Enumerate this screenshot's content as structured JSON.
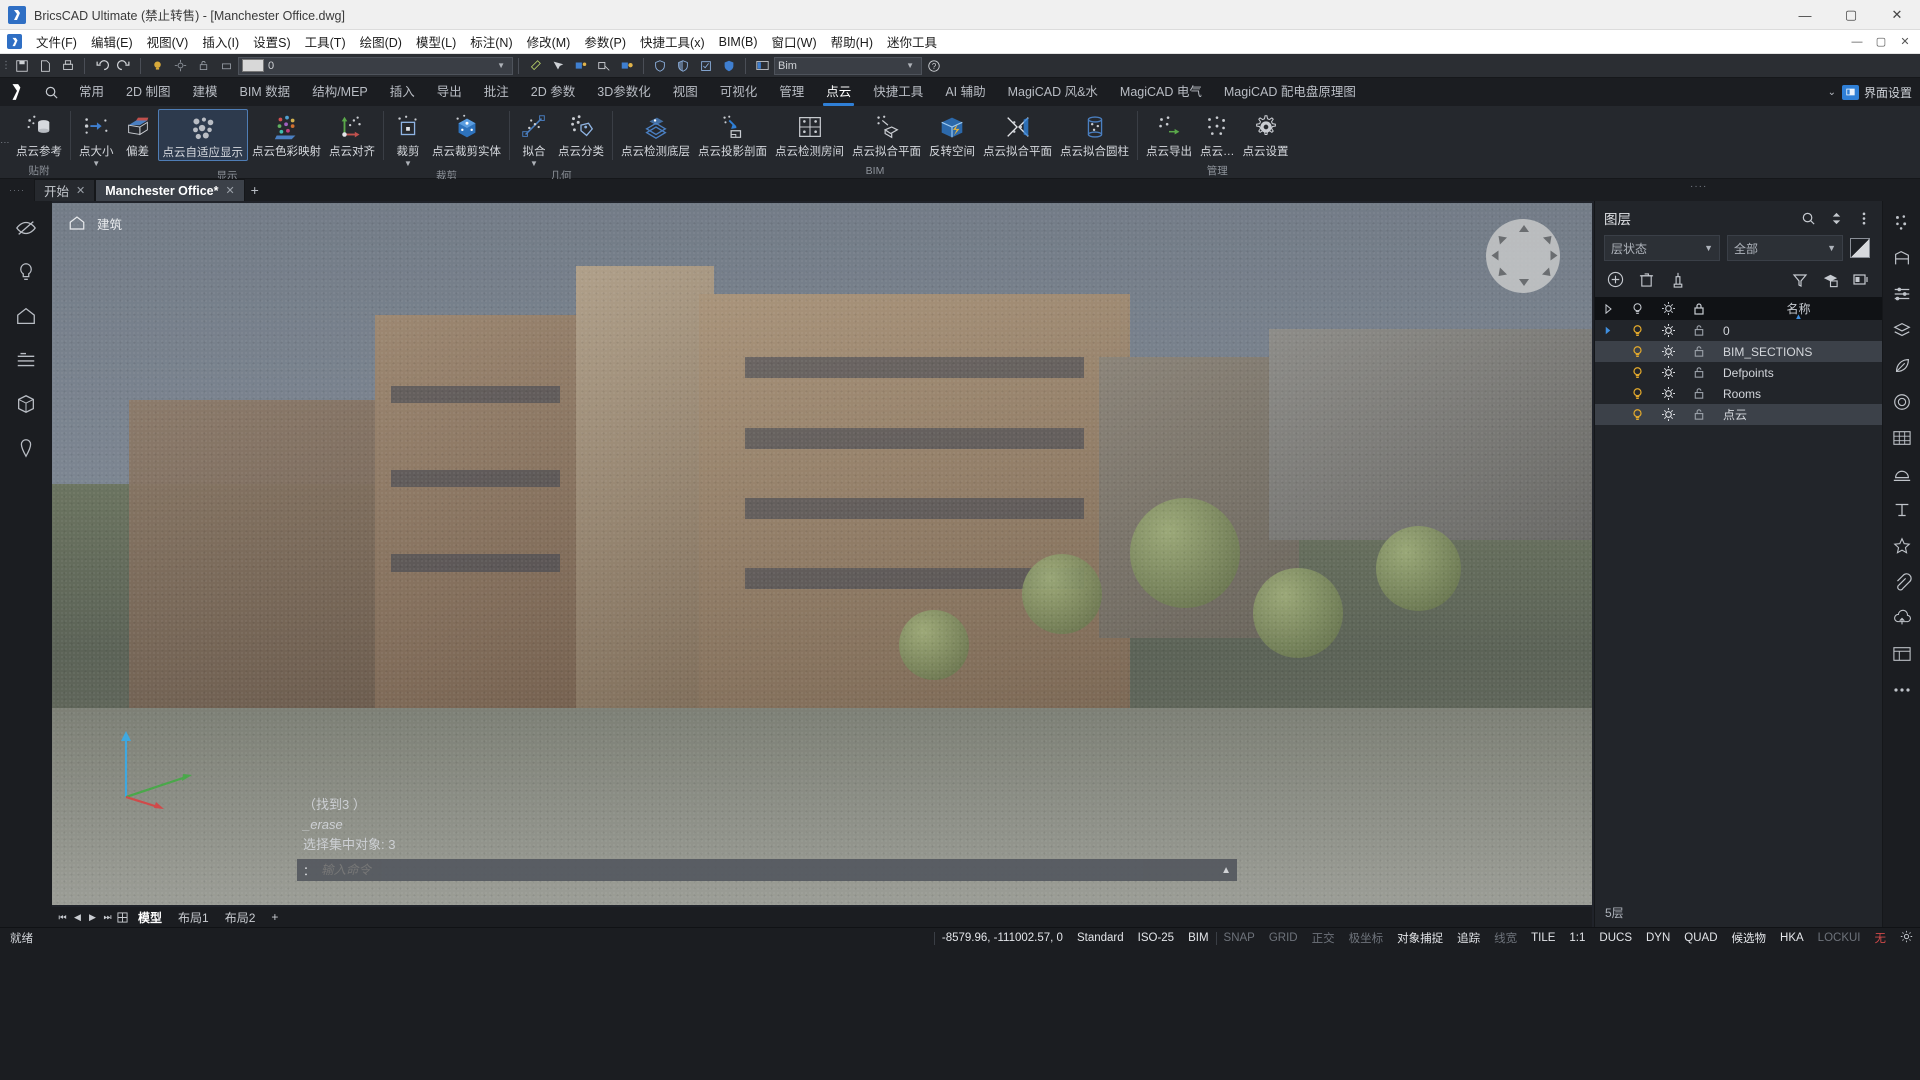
{
  "titlebar": {
    "app_title": "BricsCAD Ultimate (禁止转售) - [Manchester Office.dwg]",
    "logo": "bricscad-logo",
    "minimize": "—",
    "maximize": "▢",
    "close": "✕"
  },
  "menubar": {
    "items": [
      {
        "label": "文件(F)"
      },
      {
        "label": "编辑(E)"
      },
      {
        "label": "视图(V)"
      },
      {
        "label": "插入(I)"
      },
      {
        "label": "设置S)"
      },
      {
        "label": "工具(T)"
      },
      {
        "label": "绘图(D)"
      },
      {
        "label": "模型(L)"
      },
      {
        "label": "标注(N)"
      },
      {
        "label": "修改(M)"
      },
      {
        "label": "参数(P)"
      },
      {
        "label": "快捷工具(x)"
      },
      {
        "label": "BIM(B)"
      },
      {
        "label": "窗口(W)"
      },
      {
        "label": "帮助(H)"
      },
      {
        "label": "迷你工具"
      }
    ],
    "right_buttons": [
      "—",
      "▢",
      "✕"
    ]
  },
  "quick_toolbar": {
    "layer_value": "0",
    "workspace_value": "Bim",
    "help_icon": "question-icon"
  },
  "ribbon_tabs": {
    "items": [
      {
        "label": "常用"
      },
      {
        "label": "2D 制图"
      },
      {
        "label": "建模"
      },
      {
        "label": "BIM 数据"
      },
      {
        "label": "结构/MEP"
      },
      {
        "label": "插入"
      },
      {
        "label": "导出"
      },
      {
        "label": "批注"
      },
      {
        "label": "2D 参数"
      },
      {
        "label": "3D参数化"
      },
      {
        "label": "视图"
      },
      {
        "label": "可视化"
      },
      {
        "label": "管理"
      },
      {
        "label": "点云"
      },
      {
        "label": "快捷工具"
      },
      {
        "label": "AI 辅助"
      },
      {
        "label": "MagiCAD 风&水"
      },
      {
        "label": "MagiCAD 电气"
      },
      {
        "label": "MagiCAD 配电盘原理图"
      }
    ],
    "active": "点云",
    "ui_settings_label": "界面设置",
    "collapse_icon": "chevron-down-icon"
  },
  "ribbon_panels": [
    {
      "group": "贴附",
      "buttons": [
        {
          "label": "点云参考",
          "icon": "point-cloud-reference-icon",
          "selected": false,
          "dropdown": false
        }
      ]
    },
    {
      "group": "显示",
      "buttons": [
        {
          "label": "点大小",
          "icon": "point-size-icon",
          "selected": false,
          "dropdown": true
        },
        {
          "label": "偏差",
          "icon": "deviation-icon",
          "selected": false,
          "dropdown": false
        },
        {
          "label": "点云自适应显示",
          "icon": "adaptive-display-icon",
          "selected": true,
          "dropdown": false
        },
        {
          "label": "点云色彩映射",
          "icon": "color-map-icon",
          "selected": false,
          "dropdown": false
        },
        {
          "label": "点云对齐",
          "icon": "align-icon",
          "selected": false,
          "dropdown": false
        }
      ]
    },
    {
      "group": "裁剪",
      "buttons": [
        {
          "label": "裁剪",
          "icon": "crop-icon",
          "selected": false,
          "dropdown": true
        },
        {
          "label": "点云裁剪实体",
          "icon": "crop-solid-icon",
          "selected": false,
          "dropdown": false
        }
      ]
    },
    {
      "group": "几何",
      "buttons": [
        {
          "label": "拟合",
          "icon": "fit-icon",
          "selected": false,
          "dropdown": true
        },
        {
          "label": "点云分类",
          "icon": "classify-icon",
          "selected": false,
          "dropdown": false
        }
      ]
    },
    {
      "group": "BIM",
      "buttons": [
        {
          "label": "点云检测底层",
          "icon": "detect-floor-icon",
          "selected": false,
          "dropdown": false
        },
        {
          "label": "点云投影剖面",
          "icon": "project-section-icon",
          "selected": false,
          "dropdown": false
        },
        {
          "label": "点云检测房间",
          "icon": "detect-room-icon",
          "selected": false,
          "dropdown": false
        },
        {
          "label": "点云拟合平面",
          "icon": "fit-plane-icon",
          "selected": false,
          "dropdown": false
        },
        {
          "label": "反转空间",
          "icon": "invert-space-icon",
          "selected": false,
          "dropdown": false
        },
        {
          "label": "点云拟合平面",
          "icon": "fit-plane2-icon",
          "selected": false,
          "dropdown": false
        },
        {
          "label": "点云拟合圆柱",
          "icon": "fit-cylinder-icon",
          "selected": false,
          "dropdown": false
        }
      ]
    },
    {
      "group": "管理",
      "buttons": [
        {
          "label": "点云导出",
          "icon": "export-icon",
          "selected": false,
          "dropdown": false
        },
        {
          "label": "点云…",
          "icon": "point-cloud-manage-icon",
          "selected": false,
          "dropdown": false
        },
        {
          "label": "点云设置",
          "icon": "settings-icon",
          "selected": false,
          "dropdown": false
        }
      ]
    }
  ],
  "document_tabs": {
    "items": [
      {
        "label": "开始",
        "active": false,
        "closable": true
      },
      {
        "label": "Manchester Office*",
        "active": true,
        "closable": true
      }
    ],
    "add_label": "+"
  },
  "left_rail": {
    "items": [
      {
        "name": "visibility-icon"
      },
      {
        "name": "light-icon"
      },
      {
        "name": "home-icon"
      },
      {
        "name": "layers-icon"
      },
      {
        "name": "box-icon"
      },
      {
        "name": "pin-icon"
      }
    ]
  },
  "right_rail": {
    "items": [
      {
        "name": "point-cloud-icon"
      },
      {
        "name": "section-icon"
      },
      {
        "name": "sliders-icon"
      },
      {
        "name": "materials-icon"
      },
      {
        "name": "leaf-icon"
      },
      {
        "name": "render-icon"
      },
      {
        "name": "grid-icon"
      },
      {
        "name": "sun-icon"
      },
      {
        "name": "text-icon"
      },
      {
        "name": "star-icon"
      },
      {
        "name": "attach-icon"
      },
      {
        "name": "cloud-upload-icon"
      },
      {
        "name": "table-icon"
      },
      {
        "name": "more-icon"
      }
    ]
  },
  "viewport": {
    "breadcrumb": "建筑",
    "home_icon": "home-icon",
    "nav_widget": "view-compass",
    "ucs_icon": "ucs-axis-icon",
    "scene": "Manchester Office point cloud"
  },
  "command_overlay": {
    "lines": [
      "（找到3 ）",
      "_erase",
      "选择集中对象:   3"
    ],
    "prompt": "：",
    "input_placeholder": "输入命令",
    "input_value": "",
    "scroll_icon": "chevron-up-icon"
  },
  "model_layout_bar": {
    "nav": [
      "⏮",
      "◀",
      "▶",
      "⏭"
    ],
    "tabs": [
      {
        "label": "模型",
        "active": true
      },
      {
        "label": "布局1",
        "active": false
      },
      {
        "label": "布局2",
        "active": false
      }
    ],
    "add": "+",
    "grid_icon": "grid-icon"
  },
  "layers_panel": {
    "title": "图层",
    "header_icons": [
      "search-icon",
      "sort-icon",
      "more-vertical-icon"
    ],
    "filter_state": "层状态",
    "filter_scope": "全部",
    "contrast_icon": "contrast-icon",
    "action_icons": [
      "add-layer-icon",
      "delete-layer-icon",
      "merge-layer-icon"
    ],
    "right_action_icons": [
      "filter-icon",
      "layer-states-icon",
      "layer-preview-icon"
    ],
    "columns": [
      {
        "name": "expand",
        "label": "▶"
      },
      {
        "name": "visibility",
        "label": "bulb-icon"
      },
      {
        "name": "freeze",
        "label": "sun-icon"
      },
      {
        "name": "lock",
        "label": "lock-icon"
      },
      {
        "name": "name",
        "label": "名称"
      }
    ],
    "sort_indicator": "▲",
    "rows": [
      {
        "name": "0",
        "current": true,
        "selected": false,
        "on": true,
        "thawed": true,
        "locked": false
      },
      {
        "name": "BIM_SECTIONS",
        "current": false,
        "selected": true,
        "on": true,
        "thawed": true,
        "locked": false
      },
      {
        "name": "Defpoints",
        "current": false,
        "selected": false,
        "on": true,
        "thawed": true,
        "locked": false
      },
      {
        "name": "Rooms",
        "current": false,
        "selected": false,
        "on": true,
        "thawed": true,
        "locked": false
      },
      {
        "name": "点云",
        "current": false,
        "selected": true,
        "on": true,
        "thawed": true,
        "locked": false
      }
    ],
    "count_label": "5层"
  },
  "status_bar": {
    "ready": "就绪",
    "coordinates": "-8579.96, -111002.57, 0",
    "items": [
      {
        "label": "Standard",
        "state": "on"
      },
      {
        "label": "ISO-25",
        "state": "on"
      },
      {
        "label": "BIM",
        "state": "on"
      },
      {
        "label": "SNAP",
        "state": "dim"
      },
      {
        "label": "GRID",
        "state": "dim"
      },
      {
        "label": "正交",
        "state": "dim"
      },
      {
        "label": "极坐标",
        "state": "dim"
      },
      {
        "label": "对象捕捉",
        "state": "on"
      },
      {
        "label": "追踪",
        "state": "on"
      },
      {
        "label": "线宽",
        "state": "dim"
      },
      {
        "label": "TILE",
        "state": "on"
      },
      {
        "label": "1:1",
        "state": "on"
      },
      {
        "label": "DUCS",
        "state": "on"
      },
      {
        "label": "DYN",
        "state": "on"
      },
      {
        "label": "QUAD",
        "state": "on"
      },
      {
        "label": "候选物",
        "state": "on"
      },
      {
        "label": "HKA",
        "state": "on"
      },
      {
        "label": "LOCKUI",
        "state": "dim"
      },
      {
        "label": "无",
        "state": "on"
      },
      {
        "label": "gear-icon",
        "state": "on"
      }
    ]
  },
  "colors": {
    "accent": "#2f7fd6",
    "ribbon_bg": "#25282d",
    "panel_bg": "#22252a",
    "dark_bg": "#1b1d21",
    "bulb_on": "#e3a92c",
    "selected_row": "#3c4149"
  }
}
